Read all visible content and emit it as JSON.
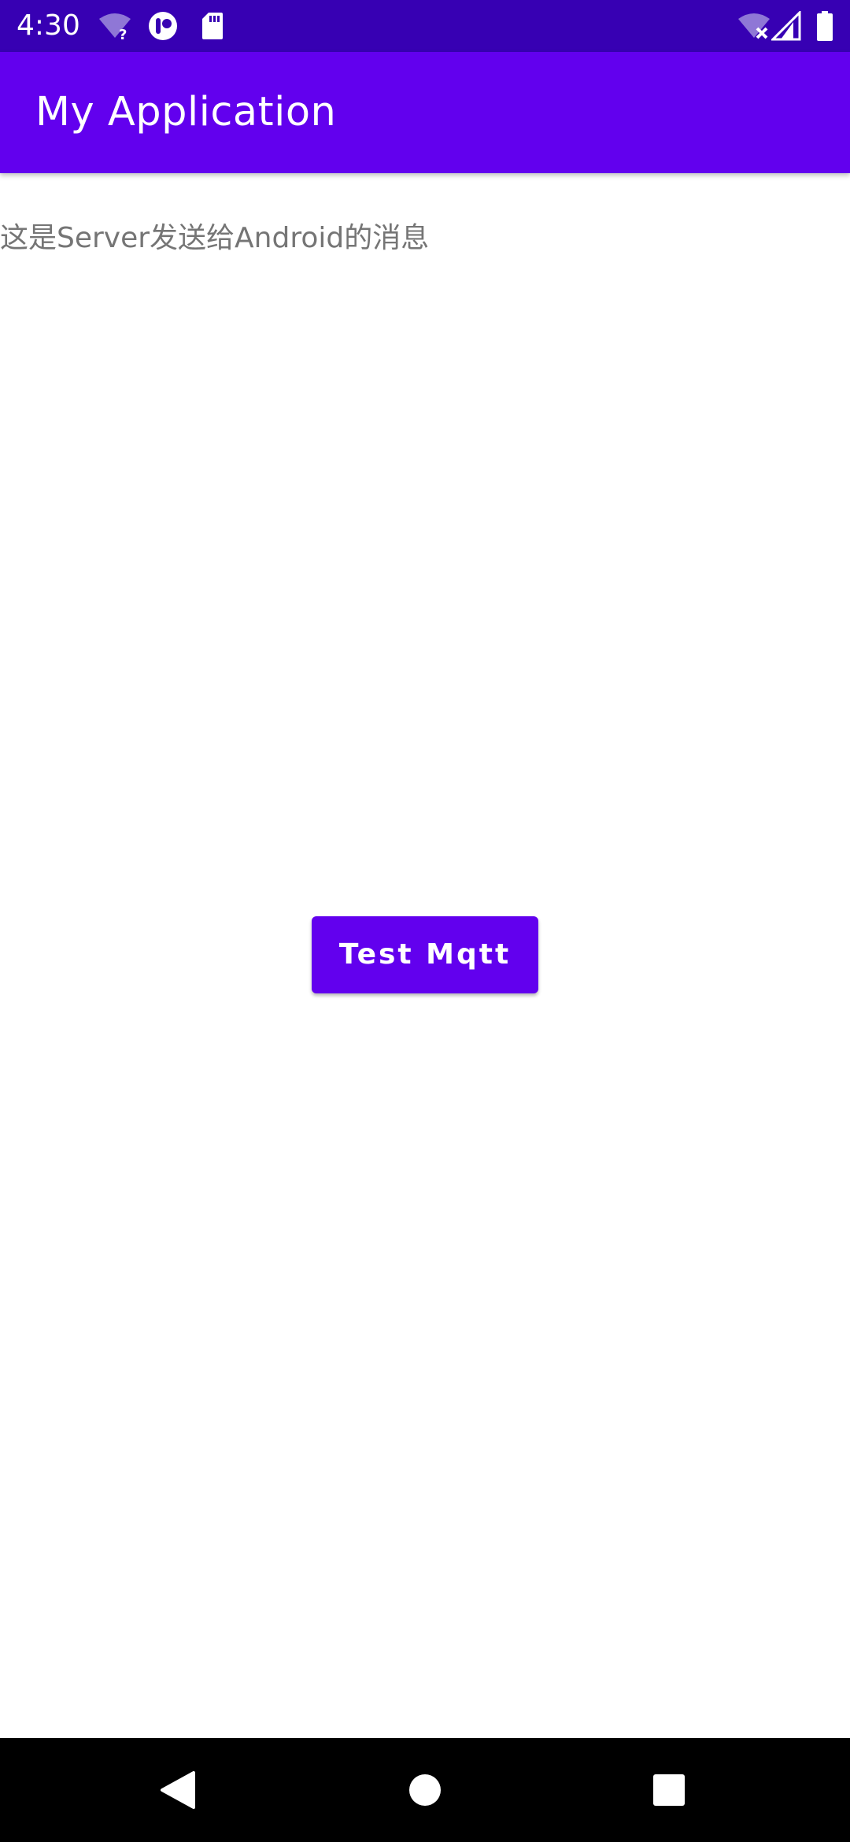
{
  "status_bar": {
    "time": "4:30",
    "left_icons": [
      "wifi-unknown-icon",
      "app-notification-icon",
      "sd-card-icon"
    ],
    "right_icons": [
      "wifi-off-icon",
      "cell-signal-icon",
      "battery-icon"
    ]
  },
  "app_bar": {
    "title": "My Application"
  },
  "main": {
    "message": "这是Server发送给Android的消息",
    "button_label": "Test Mqtt"
  },
  "nav_bar": {
    "buttons": [
      "back-icon",
      "home-icon",
      "recents-icon"
    ]
  },
  "colors": {
    "status_bar": "#3700B3",
    "primary": "#6200EE",
    "message_text": "#757575",
    "nav_bar": "#000000"
  }
}
